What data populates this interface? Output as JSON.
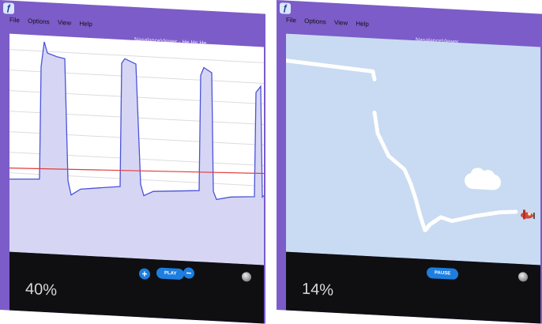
{
  "app_icon": "app-logo-icon",
  "menu": {
    "file": "File",
    "options": "Options",
    "view": "View",
    "help": "Help"
  },
  "windows": {
    "left": {
      "title": "NasalanceViewer - He He He",
      "percent": "40%",
      "controls": {
        "play_label": "PLAY",
        "plus_icon": "+",
        "minus_icon": "−"
      },
      "colors": {
        "signal_line": "#4b53d8",
        "signal_fill": "#d6d6f4",
        "threshold": "#e23b3b"
      }
    },
    "right": {
      "title": "NasalanceViewer",
      "percent": "14%",
      "controls": {
        "pause_label": "PAUSE"
      },
      "colors": {
        "sky": "#c9dbf2",
        "trail": "#ffffff"
      }
    }
  },
  "window_buttons": {
    "minimize": "–",
    "maximize": "□",
    "close": "✕"
  }
}
